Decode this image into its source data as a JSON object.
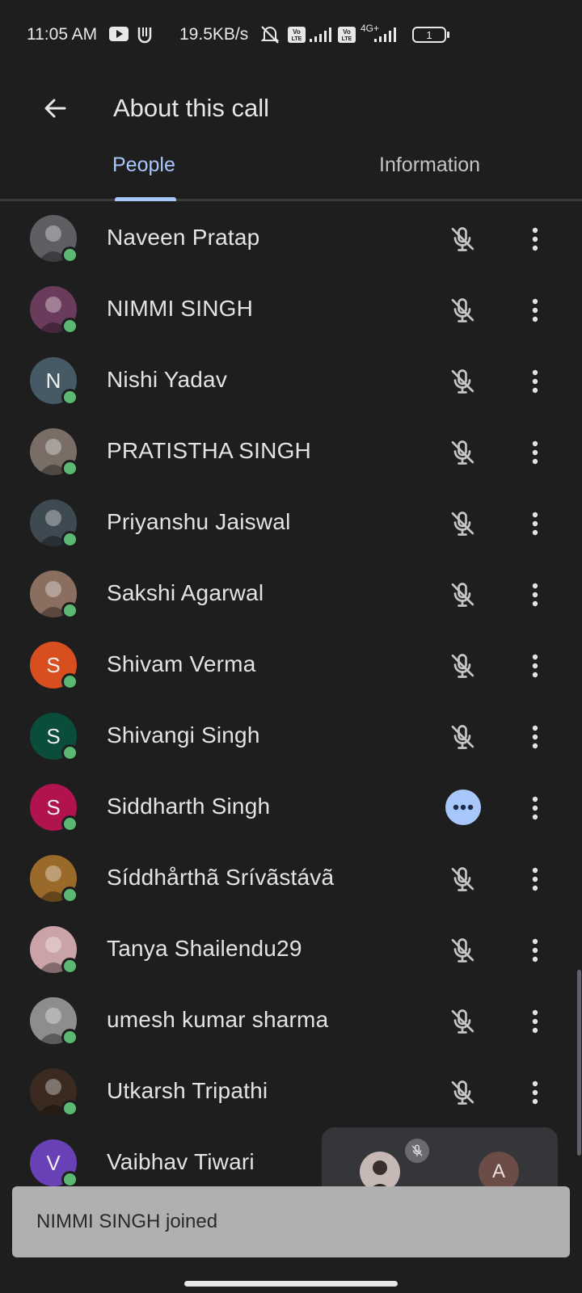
{
  "status_bar": {
    "time": "11:05 AM",
    "net_speed": "19.5KB/s",
    "network_label": "4G+",
    "volte_label": "Vo LTE",
    "battery": "1"
  },
  "app_bar": {
    "title": "About this call",
    "back_icon": "arrow-back-icon"
  },
  "tabs": [
    {
      "label": "People",
      "selected": true
    },
    {
      "label": "Information",
      "selected": false
    }
  ],
  "participants": [
    {
      "name": "Naveen Pratap",
      "avatar_type": "photo",
      "avatar_color": "#5d5f63",
      "status": "muted"
    },
    {
      "name": "NIMMI SINGH",
      "avatar_type": "photo",
      "avatar_color": "#6a3b5b",
      "status": "muted"
    },
    {
      "name": "Nishi Yadav",
      "avatar_type": "initial",
      "initial": "N",
      "avatar_color": "#455a64",
      "status": "muted"
    },
    {
      "name": "PRATISTHA SINGH",
      "avatar_type": "photo",
      "avatar_color": "#7a6d66",
      "status": "muted"
    },
    {
      "name": "Priyanshu Jaiswal",
      "avatar_type": "photo",
      "avatar_color": "#3e4a52",
      "status": "muted"
    },
    {
      "name": "Sakshi Agarwal",
      "avatar_type": "photo",
      "avatar_color": "#8a6e60",
      "status": "muted"
    },
    {
      "name": "Shivam Verma",
      "avatar_type": "initial",
      "initial": "S",
      "avatar_color": "#d84e1e",
      "status": "muted"
    },
    {
      "name": "Shivangi Singh",
      "avatar_type": "initial",
      "initial": "S",
      "avatar_color": "#0b4d3b",
      "status": "muted"
    },
    {
      "name": "Siddharth Singh",
      "avatar_type": "initial",
      "initial": "S",
      "avatar_color": "#b0134e",
      "status": "speaking"
    },
    {
      "name": "Síddhårthã Srívãstávã",
      "avatar_type": "photo",
      "avatar_color": "#9a6a2a",
      "status": "muted"
    },
    {
      "name": "Tanya Shailendu29",
      "avatar_type": "photo",
      "avatar_color": "#c9a3a8",
      "status": "muted"
    },
    {
      "name": "umesh kumar sharma",
      "avatar_type": "photo",
      "avatar_color": "#8d8d8d",
      "status": "muted"
    },
    {
      "name": "Utkarsh Tripathi",
      "avatar_type": "photo",
      "avatar_color": "#3b2a20",
      "status": "muted"
    },
    {
      "name": "Vaibhav Tiwari",
      "avatar_type": "initial",
      "initial": "V",
      "avatar_color": "#6741b5",
      "status": "none"
    }
  ],
  "pip": {
    "second_initial": "A",
    "second_color": "#6b4c47"
  },
  "snackbar": {
    "message": "NIMMI SINGH joined"
  },
  "colors": {
    "background": "#1e1e1f",
    "accent": "#a8c7fa",
    "presence": "#5bb974"
  }
}
